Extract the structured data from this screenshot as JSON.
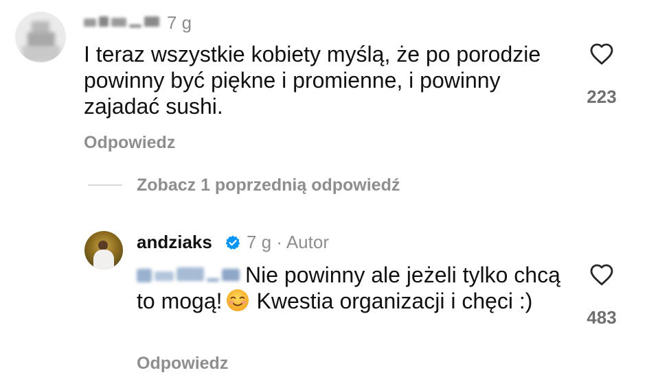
{
  "comment1": {
    "author_visible": "yukie_to",
    "time": "7 g",
    "text": "I teraz wszystkie kobiety myślą, że po porodzie powinny być piękne i promienne, i powinny zajadać sushi.",
    "reply_label": "Odpowiedz",
    "likes": "223",
    "like_icon": "heart-outline-icon"
  },
  "thread": {
    "see_previous_label": "Zobacz 1 poprzednią odpowiedź"
  },
  "comment2": {
    "author": "andziaks",
    "verified_color": "#0095f6",
    "time": "7 g",
    "meta": "· Autor",
    "mention_visible": "@yukie_to",
    "text_part1": "Nie powinny ale jeżeli tylko chcą to mogą!",
    "emoji_name": "smiling-face-emoji",
    "text_part2": "Kwestia organizacji i chęci :)",
    "reply_label": "Odpowiedz",
    "likes": "483",
    "like_icon": "heart-outline-icon"
  }
}
